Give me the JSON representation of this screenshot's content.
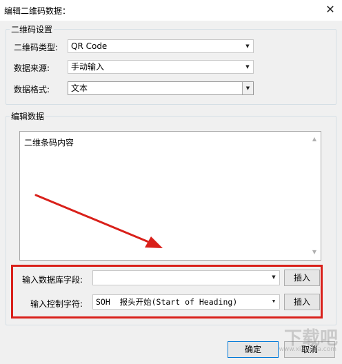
{
  "window": {
    "title": "编辑二维码数据：",
    "close_glyph": "✕"
  },
  "settings_group": {
    "label": "二维码设置",
    "rows": [
      {
        "label": "二维码类型:",
        "value": "QR Code"
      },
      {
        "label": "数据来源:",
        "value": "手动输入"
      },
      {
        "label": "数据格式:",
        "value": "文本"
      }
    ]
  },
  "edit_group": {
    "label": "编辑数据",
    "content": "二维条码内容",
    "db_field": {
      "label": "输入数据库字段:",
      "value": "",
      "insert_label": "插入"
    },
    "control_char": {
      "label": "输入控制字符:",
      "value": "SOH  报头开始(Start of Heading)",
      "insert_label": "插入"
    }
  },
  "footer": {
    "ok_label": "确定",
    "cancel_label": "取消"
  },
  "watermark": {
    "main": "下载吧",
    "sub": "www.xiazaiba.com"
  },
  "colors": {
    "highlight": "#d9201a",
    "arrow": "#d9201a"
  },
  "icons": {
    "dropdown": "triangle-down-icon",
    "close": "close-icon",
    "scroll_up": "scroll-up-icon",
    "scroll_down": "scroll-down-icon"
  }
}
